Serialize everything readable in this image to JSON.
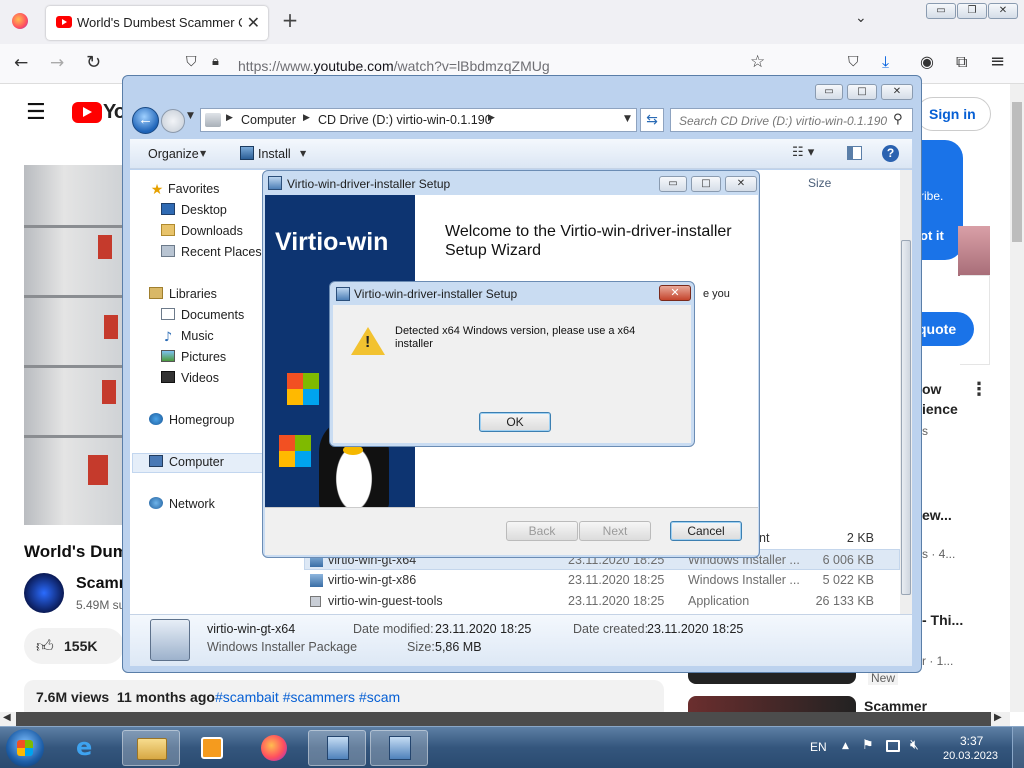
{
  "browser": {
    "tab_title": "World's Dumbest Scammer Cal",
    "tab_close": "✕",
    "new_tab": "+",
    "url_prefix": "https://www.",
    "url_host": "youtube.com",
    "url_path": "/watch?v=lBbdmzqZMUg",
    "win_minimize": "▭",
    "win_restore": "❐",
    "win_close": "✕"
  },
  "youtube": {
    "logo_text": "Yo",
    "sign_in": "Sign in",
    "panel_line1": "ribe.",
    "panel_line2": "ot it",
    "quote_label": "quote",
    "video_title": "World's Dum",
    "channel_name": "Scamm",
    "subscribers": "5.49M su",
    "likes": "155K",
    "views_line": "7.6M views  11 months ago",
    "hashtags": "#scambait #scammers #scam",
    "side": [
      {
        "t": "ow",
        "s": "ience"
      },
      {
        "t": "s",
        "s": ""
      },
      {
        "t": "ew...",
        "s": "s · 4..."
      },
      {
        "t": "- Thi...",
        "s": "r · 1..."
      },
      {
        "t": "New",
        "s": ""
      },
      {
        "t": "Scammer",
        "s": ""
      }
    ]
  },
  "explorer": {
    "breadcrumb": [
      "Computer",
      "CD Drive (D:) virtio-win-0.1.190"
    ],
    "search_placeholder": "Search CD Drive (D:) virtio-win-0.1.190",
    "organize": "Organize",
    "install": "Install",
    "col_size": "Size",
    "nav": {
      "favorites": "Favorites",
      "desktop": "Desktop",
      "downloads": "Downloads",
      "recent": "Recent Places",
      "libraries": "Libraries",
      "documents": "Documents",
      "music": "Music",
      "pictures": "Pictures",
      "videos": "Videos",
      "homegroup": "Homegroup",
      "computer": "Computer",
      "network": "Network"
    },
    "files": [
      {
        "name": "",
        "date": "",
        "type": "nt",
        "size": "2 KB"
      },
      {
        "name": "virtio-win-gt-x64",
        "date": "23.11.2020 18:25",
        "type": "Windows Installer ...",
        "size": "6 006 KB"
      },
      {
        "name": "virtio-win-gt-x86",
        "date": "23.11.2020 18:25",
        "type": "Windows Installer ...",
        "size": "5 022 KB"
      },
      {
        "name": "virtio-win-guest-tools",
        "date": "23.11.2020 18:25",
        "type": "Application",
        "size": "26 133 KB"
      }
    ],
    "details": {
      "name": "virtio-win-gt-x64",
      "type": "Windows Installer Package",
      "modified_label": "Date modified:",
      "modified": "23.11.2020 18:25",
      "created_label": "Date created:",
      "created": "23.11.2020 18:25",
      "size_label": "Size:",
      "size": "5,86 MB"
    }
  },
  "setup": {
    "title": "Virtio-win-driver-installer Setup",
    "banner": "Virtio-win",
    "welcome": "Welcome to the Virtio-win-driver-installer Setup Wizard",
    "partial_text": "e you",
    "back": "Back",
    "next": "Next",
    "cancel": "Cancel"
  },
  "dialog": {
    "title": "Virtio-win-driver-installer Setup",
    "message": "Detected x64 Windows version, please use a x64 installer",
    "ok": "OK",
    "close": "✕"
  },
  "taskbar": {
    "lang": "EN",
    "time": "3:37",
    "date": "20.03.2023"
  }
}
